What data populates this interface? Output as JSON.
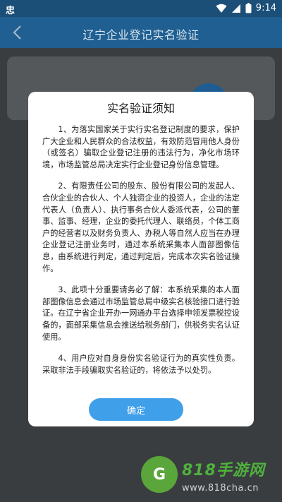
{
  "status_bar": {
    "app_icon": "忠",
    "time": "9:14"
  },
  "header": {
    "title": "辽宁企业登记实名验证"
  },
  "dialog": {
    "title": "实名验证须知",
    "paragraphs": [
      "1、为落实国家关于实行实名登记制度的要求，保护广大企业和人民群众的合法权益，有效防范冒用他人身份（或签名）骗取企业登记注册的违法行为，净化市场环境，市场监管总局决定实行企业登记身份信息管理。",
      "2、有限责任公司的股东、股份有限公司的发起人、合伙企业的合伙人、个人独资企业的投资人，企业的法定代表人（负责人）、执行事务合伙人委派代表，公司的董事、监事、经理，企业的委托代理人、联络员，个体工商户的经营者以及财务负责人、办税人等自然人应当在办理企业登记注册业务时，通过本系统采集本人面部图像信息，由系统进行判定，通过判定后，完成本次实名验证操作。",
      "3、此项十分重要请务必了解：本系统采集的本人面部图像信息会通过市场监管总局中级实名核验接口进行验证。在辽宁省企业开办一网通办平台选择申领发票税控设备的，面部采集信息会推送给税务部门，供税务实名认证使用。",
      "4、用户应对自身身份实名验证行为的真实性负责。采取非法手段骗取实名验证的，将依法予以处罚。"
    ],
    "confirm_label": "确定"
  },
  "watermark": {
    "logo_letter": "G",
    "name": "818手游网",
    "url": "www.818cha.cn"
  },
  "colors": {
    "header_bg": "#1f5f91",
    "button": "#3f9fe8",
    "watermark_green": "#4fb13c"
  }
}
